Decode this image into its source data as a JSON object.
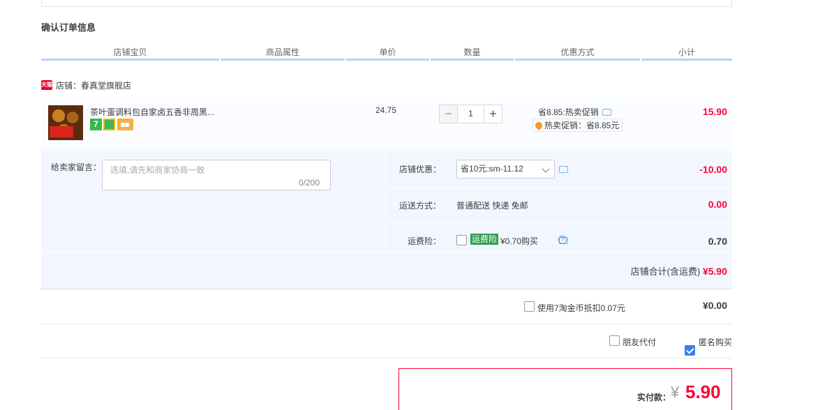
{
  "section_title": "确认订单信息",
  "columns": [
    "店铺宝贝",
    "商品属性",
    "单价",
    "数量",
    "优惠方式",
    "小计"
  ],
  "shop": {
    "badge": "天猫",
    "name": "店铺：春真堂旗舰店"
  },
  "item": {
    "title": "茶叶蛋调料包自家卤五香非周黑...",
    "icon_names": [
      "seven-day-return-icon",
      "guarantee-icon",
      "card-pay-icon"
    ],
    "icon_7_label": "7",
    "unit_price": "24.75",
    "quantity": "1",
    "minus_label": "−",
    "plus_label": "+",
    "promo_main": "省8.85:热卖促销",
    "promo_tag": "热卖促销：省8.85元",
    "subtotal": "15.90"
  },
  "memo": {
    "label": "给卖家留言：",
    "placeholder": "选填,请先和商家协商一致",
    "count": "0/200"
  },
  "coupon": {
    "label": "店铺优惠：",
    "selected": "省10元:sm-11.12",
    "amount": "-10.00"
  },
  "shipping": {
    "label": "运送方式：",
    "value": "普通配送 快递 免邮",
    "amount": "0.00"
  },
  "insurance": {
    "label": "运费险：",
    "tag": "运费险",
    "text": "¥0.70购买",
    "help": "?",
    "amount": "0.70"
  },
  "shop_total": {
    "label": "店铺合计(含运费)",
    "value": "¥5.90"
  },
  "coins": {
    "label": "使用7淘金币抵扣0.07元",
    "amount": "¥0.00"
  },
  "friend_pay": {
    "label": "朋友代付",
    "checked": false
  },
  "anonymous": {
    "label": "匿名购买",
    "checked": true
  },
  "pay": {
    "label": "实付款：",
    "currency": "¥",
    "value": "5.90"
  },
  "colors": {
    "accent": "#ff0036",
    "header_line": "#b2d1ff",
    "panel": "#f2f7ff",
    "check": "#3d7cf0"
  }
}
